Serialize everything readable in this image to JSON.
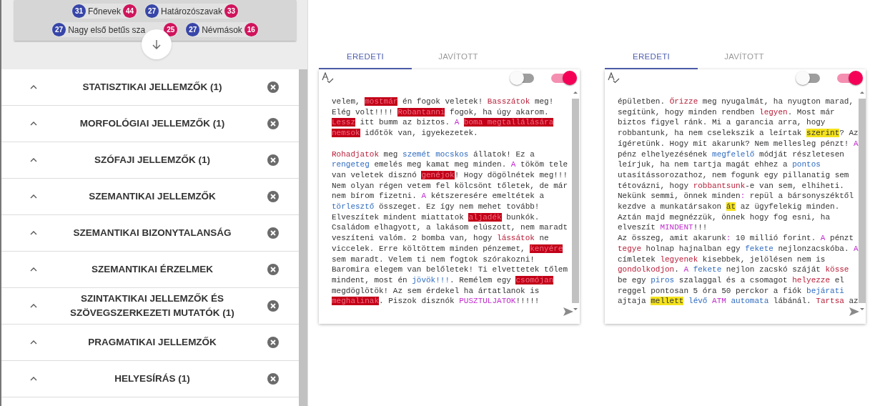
{
  "summary_chips": [
    {
      "left_count": "31",
      "label": "Főnevek",
      "right_count": "44"
    },
    {
      "left_count": "27",
      "label": "Határozószavak",
      "right_count": "33"
    },
    {
      "left_count": "27",
      "label": "Nagy első betűs sza",
      "right_count": "25"
    },
    {
      "left_count": "27",
      "label": "Névmások",
      "right_count": "16"
    }
  ],
  "sections": [
    {
      "title": "STATISZTIKAI JELLEMZŐK (1)"
    },
    {
      "title": "MORFOLÓGIAI JELLEMZŐK (1)"
    },
    {
      "title": "SZÓFAJI JELLEMZŐK (1)"
    },
    {
      "title": "SZEMANTIKAI JELLEMZŐK"
    },
    {
      "title": "SZEMANTIKAI BIZONYTALANSÁG"
    },
    {
      "title": "SZEMANTIKAI ÉRZELMEK"
    },
    {
      "title": "SZINTAKTIKAI JELLEMZŐK ÉS SZÖVEGSZERKEZETI MUTATÓK (1)"
    },
    {
      "title": "PRAGMATIKAI JELLEMZŐK"
    },
    {
      "title": "HELYESÍRÁS (1)"
    }
  ],
  "editors": [
    {
      "tabs": [
        {
          "label": "EREDETI",
          "selected": true
        },
        {
          "label": "JAVÍTOTT",
          "selected": false
        }
      ],
      "toggles": [
        {
          "on": false
        },
        {
          "on": true
        }
      ],
      "paragraphs": [
        [
          [
            {
              "text": "velem, ",
              "kind": "plain"
            },
            {
              "text": "mostmár",
              "kind": "flagged"
            },
            {
              "text": " én fogok veletek! ",
              "kind": "plain"
            },
            {
              "text": "Basszátok",
              "kind": "red"
            },
            {
              "text": " meg!",
              "kind": "plain"
            }
          ],
          [
            {
              "text": "Elég volt!!!! ",
              "kind": "plain"
            },
            {
              "text": "Robantanni",
              "kind": "flagged"
            },
            {
              "text": " fogok, ha úgy akarom.",
              "kind": "plain"
            }
          ],
          [
            {
              "text": "Lessz",
              "kind": "flagged"
            },
            {
              "text": " itt bumm az biztos. ",
              "kind": "plain"
            },
            {
              "text": "A ",
              "kind": "magenta"
            },
            {
              "text": "boma megtallálására",
              "kind": "flagged"
            }
          ],
          [
            {
              "text": "nemsok",
              "kind": "flagged"
            },
            {
              "text": " időtök van, igyekezetek.",
              "kind": "plain"
            }
          ]
        ],
        [
          [
            {
              "text": "Rohadjatok",
              "kind": "red"
            },
            {
              "text": " meg ",
              "kind": "plain"
            },
            {
              "text": "szemét mocskos",
              "kind": "blue"
            },
            {
              "text": " állatok! Ez a",
              "kind": "plain"
            }
          ],
          [
            {
              "text": "rengeteg",
              "kind": "blue"
            },
            {
              "text": " emelés meg kamat meg minden. ",
              "kind": "plain"
            },
            {
              "text": "A",
              "kind": "magenta"
            },
            {
              "text": " tököm tele",
              "kind": "plain"
            }
          ],
          [
            {
              "text": "van veletek disznó ",
              "kind": "plain"
            },
            {
              "text": "genéjok",
              "kind": "flagged"
            },
            {
              "text": "! Hogy dögölnétek meg!!!",
              "kind": "plain"
            }
          ],
          [
            {
              "text": "Nem olyan régen vetem fel kölcsönt tőletek, de már",
              "kind": "plain"
            }
          ],
          [
            {
              "text": "nem bírom fizetni. ",
              "kind": "plain"
            },
            {
              "text": "A",
              "kind": "magenta"
            },
            {
              "text": " kétszeresére emeltétek a",
              "kind": "plain"
            }
          ],
          [
            {
              "text": "törlesztő",
              "kind": "blue"
            },
            {
              "text": " összeget. Ez így nem mehet tovább!",
              "kind": "plain"
            }
          ],
          [
            {
              "text": "Elveszítek mindent miattatok ",
              "kind": "plain"
            },
            {
              "text": "aljadék",
              "kind": "flagged"
            },
            {
              "text": " bunkók.",
              "kind": "plain"
            }
          ],
          [
            {
              "text": "Családom elhagyott, a lakásom elúszott, nem maradt",
              "kind": "plain"
            }
          ],
          [
            {
              "text": "veszíteni valóm. 2 bomba van, hogy ",
              "kind": "plain"
            },
            {
              "text": "lássátok",
              "kind": "red"
            },
            {
              "text": " ne",
              "kind": "plain"
            }
          ],
          [
            {
              "text": "viccelek. Erre költöttem minden pénzemet, ",
              "kind": "plain"
            },
            {
              "text": "kenyére",
              "kind": "flagged"
            }
          ],
          [
            {
              "text": "sem maradt. Velem ti nem fogtok szórakozni!",
              "kind": "plain"
            }
          ],
          [
            {
              "text": "Baromira elegem van belőletek! Ti elvettetek tőlem",
              "kind": "plain"
            }
          ],
          [
            {
              "text": "mindent, most én ",
              "kind": "plain"
            },
            {
              "text": "jövök!!!",
              "kind": "blue"
            },
            {
              "text": ". Remélem egy ",
              "kind": "plain"
            },
            {
              "text": "csomójan",
              "kind": "flagged"
            }
          ],
          [
            {
              "text": "megdöglötök! Az sem érdekel ha ártatlanok is",
              "kind": "plain"
            }
          ],
          [
            {
              "text": "meghalinak",
              "kind": "flagged"
            },
            {
              "text": ". Piszok disznók ",
              "kind": "plain"
            },
            {
              "text": "PUSZTULJATOK",
              "kind": "magenta"
            },
            {
              "text": "!!!!!",
              "kind": "plain"
            }
          ]
        ]
      ]
    },
    {
      "tabs": [
        {
          "label": "EREDETI",
          "selected": true
        },
        {
          "label": "JAVÍTOTT",
          "selected": false
        }
      ],
      "toggles": [
        {
          "on": false
        },
        {
          "on": true
        }
      ],
      "paragraphs": [
        [
          [
            {
              "text": "épületben. ",
              "kind": "plain"
            },
            {
              "text": "Őrizze",
              "kind": "red"
            },
            {
              "text": " meg nyugalmát, ha nyugton marad,",
              "kind": "plain"
            }
          ],
          [
            {
              "text": "segítünk, hogy minden rendben ",
              "kind": "plain"
            },
            {
              "text": "legyen",
              "kind": "red"
            },
            {
              "text": ". Most már",
              "kind": "plain"
            }
          ],
          [
            {
              "text": "biztos figyel ránk. Mi a garancia arra, hogy",
              "kind": "plain"
            }
          ],
          [
            {
              "text": "robbantunk, ha nem cselekszik a leírtak ",
              "kind": "plain"
            },
            {
              "text": "szerint",
              "kind": "marked"
            },
            {
              "text": "? Az",
              "kind": "plain"
            }
          ],
          [
            {
              "text": "ígéretünk. Hogy mit akarunk? Nem mellesleg pénzt! ",
              "kind": "plain"
            },
            {
              "text": "A",
              "kind": "magenta"
            }
          ],
          [
            {
              "text": "pénz elhelyezésének ",
              "kind": "plain"
            },
            {
              "text": "megfelelő",
              "kind": "blue"
            },
            {
              "text": " módját részletesen",
              "kind": "plain"
            }
          ],
          [
            {
              "text": "leírjuk, ha nem tartja magát ehhez a ",
              "kind": "plain"
            },
            {
              "text": "pontos",
              "kind": "blue"
            }
          ],
          [
            {
              "text": "utasítássorozathoz, nem fogunk egy pillanatig sem",
              "kind": "plain"
            }
          ],
          [
            {
              "text": "tétovázni, hogy ",
              "kind": "plain"
            },
            {
              "text": "robbantsunk",
              "kind": "red"
            },
            {
              "text": "-e van sem, elhiheti.",
              "kind": "plain"
            }
          ],
          [
            {
              "text": "Nekünk semmi, önnek minden",
              "kind": "plain"
            },
            {
              "text": ":",
              "kind": "magenta"
            },
            {
              "text": " repül a bársonyszéktől",
              "kind": "plain"
            }
          ],
          [
            {
              "text": "kezdve a munkatársakon ",
              "kind": "plain"
            },
            {
              "text": "át",
              "kind": "marked"
            },
            {
              "text": " az ügyfelekig minden.",
              "kind": "plain"
            }
          ],
          [
            {
              "text": "Aztán majd megnézzük, önnek hogy fog esni, ha",
              "kind": "plain"
            }
          ],
          [
            {
              "text": "elveszít ",
              "kind": "plain"
            },
            {
              "text": "MINDENT",
              "kind": "magenta"
            },
            {
              "text": "!!!",
              "kind": "plain"
            }
          ],
          [
            {
              "text": "Az összeg, amit akarunk",
              "kind": "plain"
            },
            {
              "text": ":",
              "kind": "magenta"
            },
            {
              "text": " 10 millió forint. ",
              "kind": "plain"
            },
            {
              "text": "A",
              "kind": "magenta"
            },
            {
              "text": " pénzt",
              "kind": "plain"
            }
          ],
          [
            {
              "text": "tegye",
              "kind": "red"
            },
            {
              "text": " holnap hajnalban egy ",
              "kind": "plain"
            },
            {
              "text": "fekete",
              "kind": "blue"
            },
            {
              "text": " nejlonzacskóba. ",
              "kind": "plain"
            },
            {
              "text": "A",
              "kind": "magenta"
            }
          ],
          [
            {
              "text": "címletek ",
              "kind": "plain"
            },
            {
              "text": "legyenek",
              "kind": "red"
            },
            {
              "text": " kisebbek, jelölésen nem is",
              "kind": "plain"
            }
          ],
          [
            {
              "text": "gondolkodjon",
              "kind": "red"
            },
            {
              "text": ". ",
              "kind": "plain"
            },
            {
              "text": "A ",
              "kind": "magenta"
            },
            {
              "text": "fekete",
              "kind": "blue"
            },
            {
              "text": " nejlon zacskó száját ",
              "kind": "plain"
            },
            {
              "text": "kösse",
              "kind": "red"
            }
          ],
          [
            {
              "text": "be egy ",
              "kind": "plain"
            },
            {
              "text": "piros",
              "kind": "blue"
            },
            {
              "text": " szalaggal és a csomagot ",
              "kind": "plain"
            },
            {
              "text": "helyezze",
              "kind": "red"
            },
            {
              "text": " el",
              "kind": "plain"
            }
          ],
          [
            {
              "text": "reggel pontosan 5 óra 50 perckor a fiók ",
              "kind": "plain"
            },
            {
              "text": "bejárati",
              "kind": "blue"
            }
          ],
          [
            {
              "text": "ajtaja ",
              "kind": "plain"
            },
            {
              "text": "mellett",
              "kind": "marked"
            },
            {
              "text": " lévő ",
              "kind": "blue"
            },
            {
              "text": "ATM ",
              "kind": "magenta"
            },
            {
              "text": "automata",
              "kind": "blue"
            },
            {
              "text": " lábánál. ",
              "kind": "plain"
            },
            {
              "text": "Tartsa",
              "kind": "red"
            },
            {
              "text": " az",
              "kind": "plain"
            }
          ]
        ]
      ]
    }
  ]
}
